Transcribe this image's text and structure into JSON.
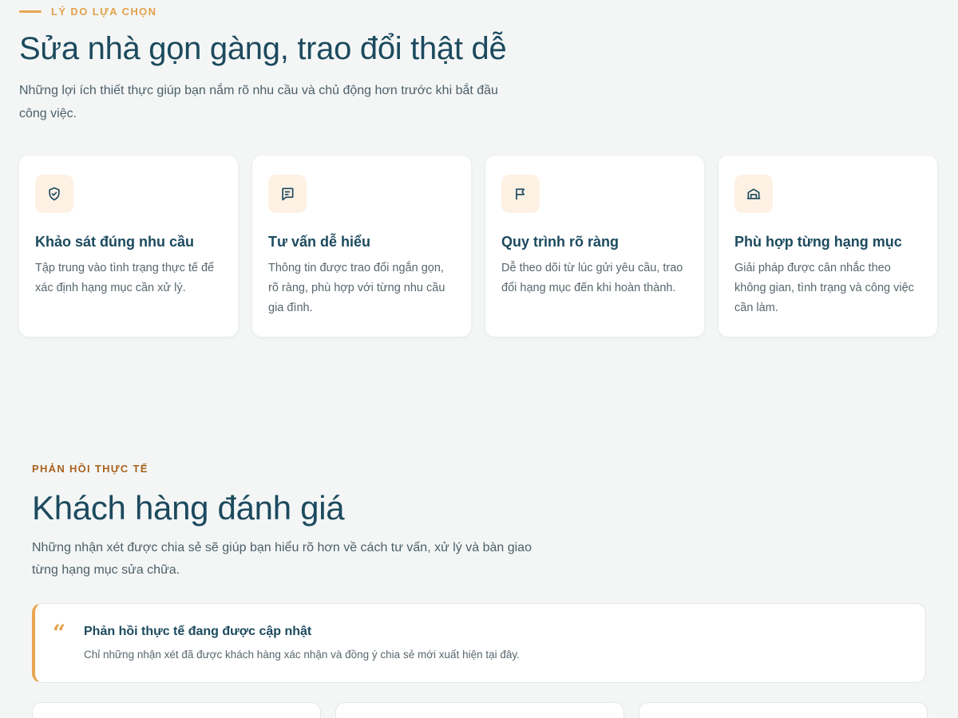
{
  "why": {
    "eyebrow": "LÝ DO LỰA CHỌN",
    "title": "Sửa nhà gọn gàng, trao đổi thật dễ",
    "description": "Những lợi ích thiết thực giúp bạn nắm rõ nhu cầu và chủ động hơn trước khi bắt đầu công việc.",
    "cards": [
      {
        "icon": "shield-check-icon",
        "title": "Khảo sát đúng nhu cầu",
        "text": "Tập trung vào tình trạng thực tế để xác định hạng mục cần xử lý."
      },
      {
        "icon": "chat-bubble-icon",
        "title": "Tư vấn dễ hiểu",
        "text": "Thông tin được trao đổi ngắn gọn, rõ ràng, phù hợp với từng nhu cầu gia đình."
      },
      {
        "icon": "flag-icon",
        "title": "Quy trình rõ ràng",
        "text": "Dễ theo dõi từ lúc gửi yêu cầu, trao đổi hạng mục đến khi hoàn thành."
      },
      {
        "icon": "home-icon",
        "title": "Phù hợp từng hạng mục",
        "text": "Giải pháp được cân nhắc theo không gian, tình trạng và công việc cần làm."
      }
    ]
  },
  "reviews": {
    "eyebrow": "PHẢN HỒI THỰC TẾ",
    "title": "Khách hàng đánh giá",
    "description": "Những nhận xét được chia sẻ sẽ giúp bạn hiểu rõ hơn về cách tư vấn, xử lý và bàn giao từng hạng mục sửa chữa.",
    "notice": {
      "quote": "“",
      "title": "Phản hồi thực tế đang được cập nhật",
      "text": "Chỉ những nhận xét đã được khách hàng xác nhận và đồng ý chia sẻ mới xuất hiện tại đây."
    }
  },
  "colors": {
    "accent": "#e8a552",
    "heading": "#1c4a5e",
    "icon_bg": "#fdf1e4",
    "background": "#f4f6f6"
  }
}
